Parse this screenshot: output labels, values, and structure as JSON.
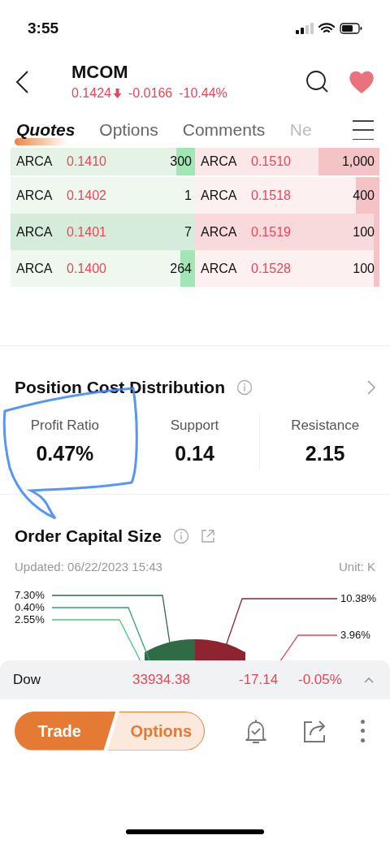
{
  "status_bar": {
    "time": "3:55"
  },
  "header": {
    "symbol": "MCOM",
    "price": "0.1424",
    "change": "-0.0166",
    "change_pct": "-10.44%",
    "favorite": true
  },
  "tabs": [
    {
      "label": "Quotes",
      "selected": true
    },
    {
      "label": "Options",
      "selected": false
    },
    {
      "label": "Comments",
      "selected": false
    },
    {
      "label": "Ne",
      "selected": false
    }
  ],
  "order_book": [
    {
      "bid_exchange": "ARCA",
      "bid_price": "0.1410",
      "bid_size": "300",
      "bid_depth": {
        "level": 0.1
      },
      "ask_exchange": "ARCA",
      "ask_price": "0.1510",
      "ask_size": "1,000",
      "ask_depth": {
        "level": 0.34
      }
    },
    {
      "bid_exchange": "ARCA",
      "bid_price": "0.1402",
      "bid_size": "1",
      "ask_exchange": "ARCA",
      "ask_price": "0.1518",
      "ask_size": "400",
      "ask_depth": {
        "level": 0.13
      }
    },
    {
      "bid_exchange": "ARCA",
      "bid_price": "0.1401",
      "bid_size": "7",
      "ask_exchange": "ARCA",
      "ask_price": "0.1519",
      "ask_size": "100",
      "ask_depth": {
        "level": 0.03
      }
    },
    {
      "bid_exchange": "ARCA",
      "bid_price": "0.1400",
      "bid_size": "264",
      "bid_depth": {
        "level": 0.08
      },
      "ask_exchange": "ARCA",
      "ask_price": "0.1528",
      "ask_size": "100",
      "ask_depth": {
        "level": 0.03
      }
    }
  ],
  "position_cost": {
    "title": "Position Cost Distribution",
    "stats": [
      {
        "label": "Profit Ratio",
        "value": "0.47%"
      },
      {
        "label": "Support",
        "value": "0.14"
      },
      {
        "label": "Resistance",
        "value": "2.15"
      }
    ]
  },
  "order_capital": {
    "title": "Order Capital Size",
    "updated": "Updated: 06/22/2023 15:43",
    "unit": "Unit: K",
    "left_callouts": [
      {
        "text": "7.30%",
        "color": "#2f6b45"
      },
      {
        "text": "0.40%",
        "color": "#3a9a78"
      },
      {
        "text": "2.55%",
        "color": "#4cc77a"
      }
    ],
    "right_callouts": [
      {
        "text": "10.38%",
        "color": "#8e2430"
      },
      {
        "text": "3.96%",
        "color": "#e0444f"
      }
    ]
  },
  "index_bar": {
    "name": "Dow",
    "value": "33934.38",
    "change": "-17.14",
    "change_pct": "-0.05%"
  },
  "bottom_bar": {
    "trade": "Trade",
    "options": "Options"
  }
}
